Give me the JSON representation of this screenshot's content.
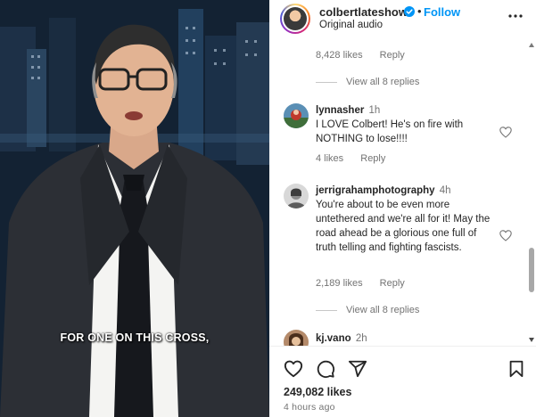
{
  "video": {
    "caption": "FOR ONE ON THIS CROSS,"
  },
  "post": {
    "username": "colbertlateshow",
    "separator": "•",
    "follow_label": "Follow",
    "audio_label": "Original audio",
    "likes": "249,082 likes",
    "time_ago": "4 hours ago"
  },
  "comments": {
    "top_reply_meta": {
      "likes": "8,428 likes",
      "reply_label": "Reply",
      "view_replies": "View all 8 replies"
    },
    "items": [
      {
        "username": "lynnasher",
        "time": "1h",
        "text": "I LOVE Colbert! He's on fire with NOTHING to lose!!!!",
        "likes": "4 likes",
        "reply_label": "Reply"
      },
      {
        "username": "jerrigrahamphotography",
        "time": "4h",
        "text": "You're about to be even more untethered and we're all for it! May the road ahead be a glorious one full of truth telling and fighting fascists.",
        "likes": "2,189 likes",
        "reply_label": "Reply",
        "view_replies": "View all 8 replies"
      },
      {
        "username": "kj.vano",
        "time": "2h"
      }
    ]
  },
  "icons": {
    "verified": "verified-badge-icon",
    "more": "more-options-icon",
    "like": "heart-icon",
    "comment": "comment-icon",
    "share": "share-icon",
    "save": "bookmark-icon"
  },
  "colors": {
    "follow_blue": "#0095f6",
    "verified_blue": "#0095f6",
    "secondary_text": "#737373"
  }
}
